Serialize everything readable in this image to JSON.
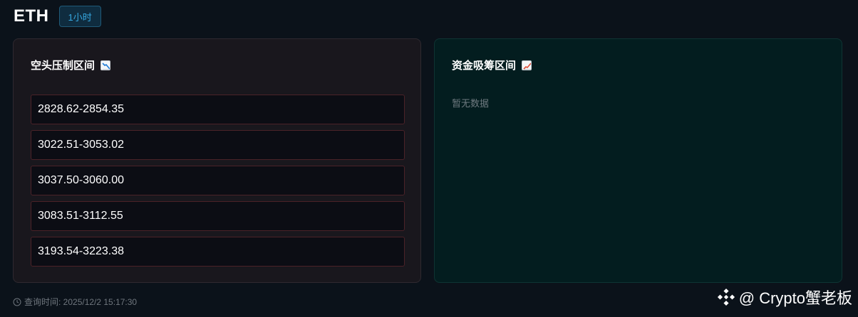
{
  "header": {
    "symbol": "ETH",
    "timeframe": "1小时"
  },
  "short_zone": {
    "title": "空头压制区间",
    "icon": "chart-decreasing-icon",
    "ranges": [
      "2828.62-2854.35",
      "3022.51-3053.02",
      "3037.50-3060.00",
      "3083.51-3112.55",
      "3193.54-3223.38"
    ]
  },
  "accumulation_zone": {
    "title": "资金吸筹区间",
    "icon": "chart-increasing-icon",
    "empty_text": "暂无数据"
  },
  "footer": {
    "query_time": "查询时间: 2025/12/2 15:17:30"
  },
  "watermark": {
    "text": "@ Crypto蟹老板",
    "icon": "binance-logo-icon"
  },
  "colors": {
    "background": "#0b121a",
    "short_panel": "#19171d",
    "accumulation_panel": "#031d1f",
    "badge_text": "#36a8e0",
    "range_border": "#4b2228"
  }
}
